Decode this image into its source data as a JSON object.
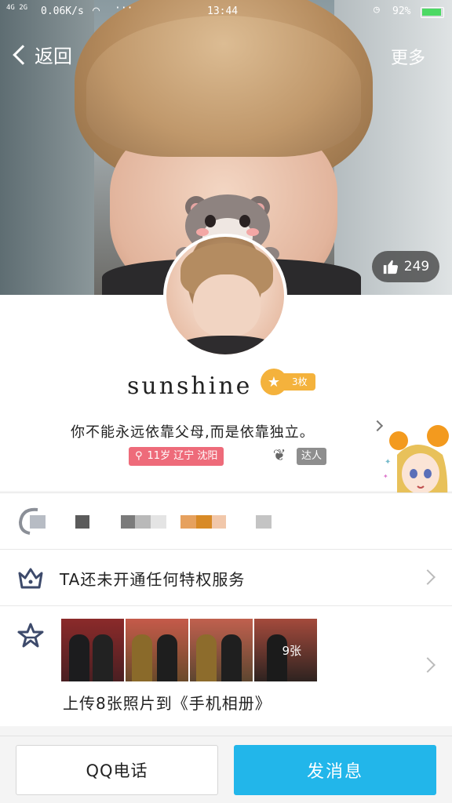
{
  "status_bar": {
    "network": "4G 2G",
    "speed": "0.06K/s",
    "time": "13:44",
    "battery": "92%",
    "battery_level": 0.92
  },
  "nav": {
    "back_label": "返回",
    "more_label": "更多"
  },
  "likes": {
    "count": "249"
  },
  "profile": {
    "name": "sunshine",
    "level_tag": "3枚",
    "signature": "你不能永远依靠父母,而是依靠独立。",
    "info": "11岁 辽宁 沈阳",
    "talent_tag": "达人"
  },
  "rows": {
    "privilege_label": "TA还未开通任何特权服务",
    "photo_count": "9张",
    "photo_caption": "上传8张照片到《手机相册》"
  },
  "buttons": {
    "call_label": "QQ电话",
    "message_label": "发消息"
  },
  "colors": {
    "accent_blue": "#22b6ea",
    "info_pink": "#ee6b7a",
    "gold": "#f4b23c"
  }
}
